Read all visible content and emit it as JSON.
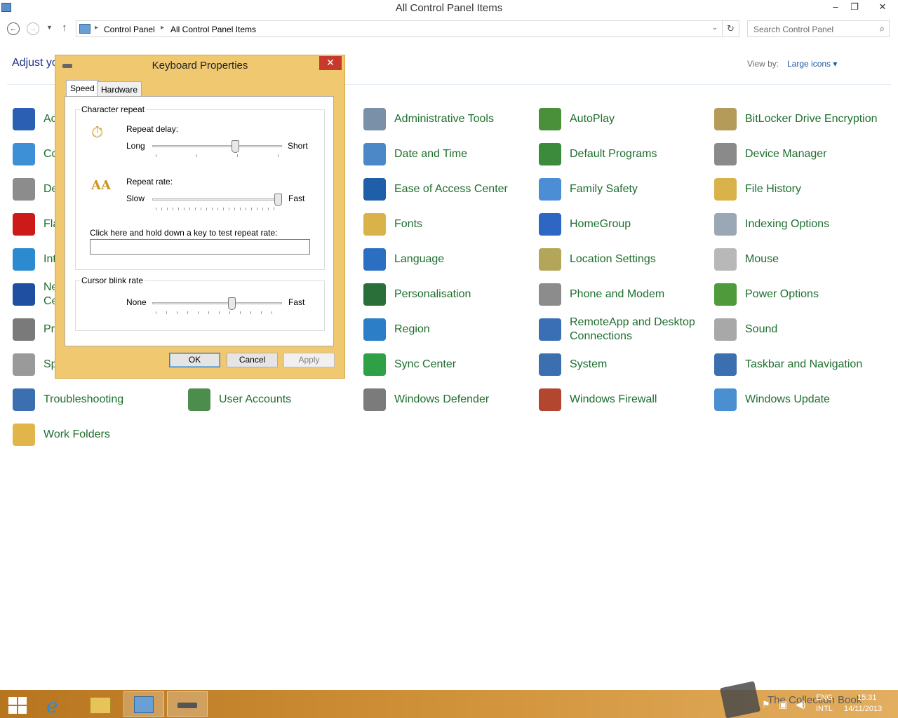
{
  "window": {
    "title": "All Control Panel Items",
    "minimize": "–",
    "restore": "❐",
    "close": "✕"
  },
  "address": {
    "crumbs": [
      "Control Panel",
      "All Control Panel Items"
    ],
    "search_placeholder": "Search Control Panel"
  },
  "header": {
    "adjust": "Adjust yo",
    "view_by_label": "View by:",
    "view_by_value": "Large icons ▾"
  },
  "items": [
    {
      "label": "Ac",
      "color": "#2a5fb4"
    },
    {
      "label": "Co",
      "color": "#3d8fd6"
    },
    {
      "label": "De",
      "color": "#8c8c8c"
    },
    {
      "label": "Fla",
      "color": "#cc1a1a"
    },
    {
      "label": "Int",
      "color": "#2b8ad0"
    },
    {
      "label": "Ne",
      "label2": "Ce",
      "color": "#1f4fa0"
    },
    {
      "label": "Pr",
      "color": "#7a7a7a"
    },
    {
      "label": "Sp",
      "color": "#9a9a9a"
    },
    {
      "label": "Troubleshooting",
      "color": "#3c6fb0"
    },
    {
      "label": "User Accounts",
      "color": "#4c8c4c"
    },
    {
      "label": "Work Folders",
      "color": "#e1b54a"
    },
    {
      "label": "Administrative Tools",
      "color": "#7a8fa8"
    },
    {
      "label": "Date and Time",
      "color": "#4c88c8"
    },
    {
      "label": "Ease of Access Center",
      "color": "#1f5ea8"
    },
    {
      "label": "Fonts",
      "color": "#d9b24a"
    },
    {
      "label": "Language",
      "color": "#2c6fc2"
    },
    {
      "label": "Personalisation",
      "color": "#2a6f3a"
    },
    {
      "label": "Region",
      "color": "#2c7fc6"
    },
    {
      "label": "Sync Center",
      "color": "#2fa045"
    },
    {
      "label": "Windows Defender",
      "color": "#7b7b7b"
    },
    {
      "label": "AutoPlay",
      "color": "#4a8f3a"
    },
    {
      "label": "Default Programs",
      "color": "#3c8a3c"
    },
    {
      "label": "Family Safety",
      "color": "#4c8ed6"
    },
    {
      "label": "HomeGroup",
      "color": "#2e66c4"
    },
    {
      "label": "Location Settings",
      "color": "#b3a65a"
    },
    {
      "label": "Phone and Modem",
      "color": "#8c8c8c"
    },
    {
      "label": "RemoteApp and Desktop Connections",
      "color": "#3a6fb5"
    },
    {
      "label": "System",
      "color": "#3c6fb0"
    },
    {
      "label": "Windows Firewall",
      "color": "#b3462e"
    },
    {
      "label": "BitLocker Drive Encryption",
      "color": "#b59b5a"
    },
    {
      "label": "Device Manager",
      "color": "#8a8a8a"
    },
    {
      "label": "File History",
      "color": "#d9b24a"
    },
    {
      "label": "Indexing Options",
      "color": "#9aa7b5"
    },
    {
      "label": "Mouse",
      "color": "#b8b8b8"
    },
    {
      "label": "Power Options",
      "color": "#4f9a3a"
    },
    {
      "label": "Sound",
      "color": "#a8a8a8"
    },
    {
      "label": "Taskbar and Navigation",
      "color": "#3c6fb0"
    },
    {
      "label": "Windows Update",
      "color": "#4a8fd0"
    }
  ],
  "dialog": {
    "title": "Keyboard Properties",
    "close": "✕",
    "tabs": [
      "Speed",
      "Hardware"
    ],
    "character_repeat": "Character repeat",
    "repeat_delay": "Repeat delay:",
    "long": "Long",
    "short": "Short",
    "repeat_delay_level": 0.65,
    "repeat_rate": "Repeat rate:",
    "slow": "Slow",
    "fast": "Fast",
    "repeat_rate_level": 1.0,
    "test_label": "Click here and hold down a key to test repeat rate:",
    "cursor_blink": "Cursor blink rate",
    "none": "None",
    "fast2": "Fast",
    "blink_level": 0.62,
    "ok": "OK",
    "cancel": "Cancel",
    "apply": "Apply"
  },
  "taskbar": {
    "lang": "ENG",
    "layout": "INTL",
    "time": "15:31",
    "date": "14/11/2013",
    "watermark": "The Collection Book"
  }
}
